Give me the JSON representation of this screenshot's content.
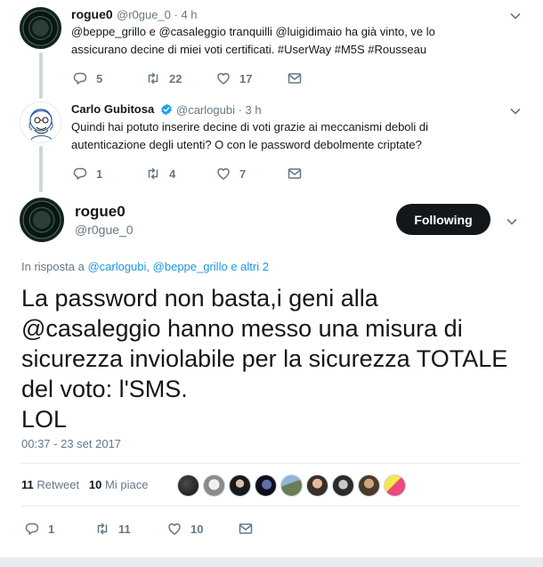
{
  "tweet1": {
    "name": "rogue0",
    "handle": "@r0gue_0 · 4 h",
    "text_line1": "@beppe_grillo e @casaleggio tranquilli @luigidimaio ha già vinto, ve lo",
    "text_line2": "assicurano decine di miei voti certificati. #UserWay #M5S #Rousseau",
    "replies": "5",
    "retweets": "22",
    "likes": "17"
  },
  "tweet2": {
    "name": "Carlo Gubitosa",
    "handle": "@carlogubi · 3 h",
    "text_line1": "Quindi hai potuto inserire decine di voti grazie ai meccanismi deboli di",
    "text_line2": "autenticazione degli utenti? O con le password debolmente criptate?",
    "replies": "1",
    "retweets": "4",
    "likes": "7"
  },
  "main": {
    "name": "rogue0",
    "handle": "@r0gue_0",
    "follow_label": "Following",
    "replying_prefix": "In risposta a",
    "replying_user1": "@carlogubi",
    "replying_sep": ",",
    "replying_user2": "@beppe_grillo",
    "replying_suffix": "e altri 2",
    "text_line1": "La password non basta,i geni alla",
    "text_line2": "@casaleggio hanno messo una misura di",
    "text_line3": "sicurezza inviolabile per la sicurezza TOTALE",
    "text_line4": "del voto: l'SMS.",
    "text_line5": "LOL",
    "timestamp": "00:37 - 23 set 2017",
    "retweet_count": "11",
    "retweet_label": "Retweet",
    "like_count": "10",
    "like_label": "Mi piace",
    "replies": "1",
    "retweets": "11",
    "likes": "10"
  },
  "colors": {
    "text": "#14171a",
    "muted": "#657786",
    "link": "#1b95e0",
    "verified": "#1da1f2",
    "divider": "#e6ecf0"
  }
}
